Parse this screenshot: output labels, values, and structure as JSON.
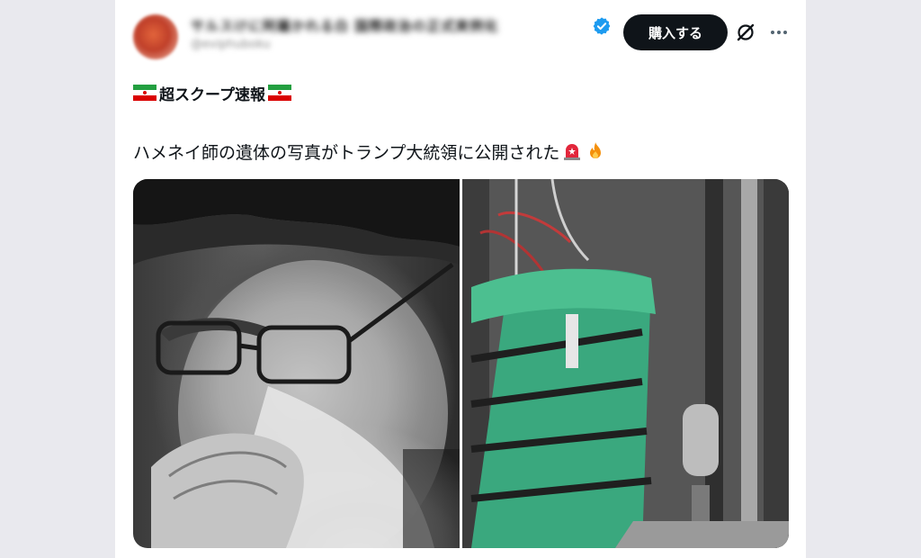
{
  "post": {
    "author_name_blurred": "サルスけに阿羅かれる白 国際政治の正式実例化",
    "author_handle_blurred": "@eviphuboku",
    "subscribe_label": "購入する",
    "headline": "超スクープ速報",
    "body": "ハメネイ師の遺体の写真がトランプ大統領に公開された"
  },
  "icons": {
    "verified": "verified-badge-icon",
    "grok": "grok-icon",
    "more": "more-options-icon",
    "flag": "iran-flag-icon",
    "siren": "rotating-light-emoji",
    "fire": "fire-emoji"
  },
  "colors": {
    "subscribe_bg": "#0f1419",
    "verified_blue": "#1d9bf0",
    "page_bg": "#e9e9ee"
  }
}
